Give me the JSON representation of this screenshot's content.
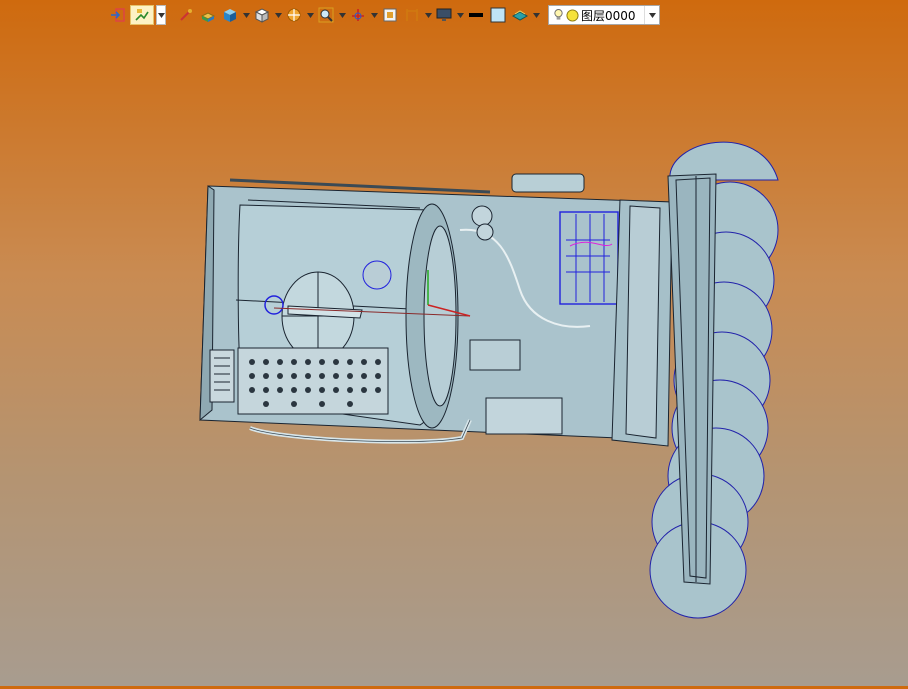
{
  "toolbar": {
    "buttons": [
      {
        "name": "exit-sketch-icon"
      },
      {
        "name": "sketch-tool-icon",
        "active": true
      },
      {
        "name": "measure-icon"
      },
      {
        "name": "part-icon"
      },
      {
        "name": "solid-box-icon"
      },
      {
        "name": "view-cube-icon"
      },
      {
        "name": "section-view-icon"
      },
      {
        "name": "zoom-fit-icon"
      },
      {
        "name": "origin-axes-icon"
      },
      {
        "name": "frame-icon"
      },
      {
        "name": "dimension-icon"
      },
      {
        "name": "display-monitor-icon"
      },
      {
        "name": "line-color-icon"
      },
      {
        "name": "fill-color-icon"
      },
      {
        "name": "layer-stack-icon"
      }
    ],
    "layer": {
      "label": "图层0000",
      "icons": [
        "lightbulb-icon",
        "layer-color-icon"
      ]
    }
  },
  "colors": {
    "background_top": "#cf6a0e",
    "background_bottom": "#a89c8f",
    "model_fill": "#a9c4cc",
    "model_edge": "#1a2430",
    "highlight": "#2222dd"
  }
}
